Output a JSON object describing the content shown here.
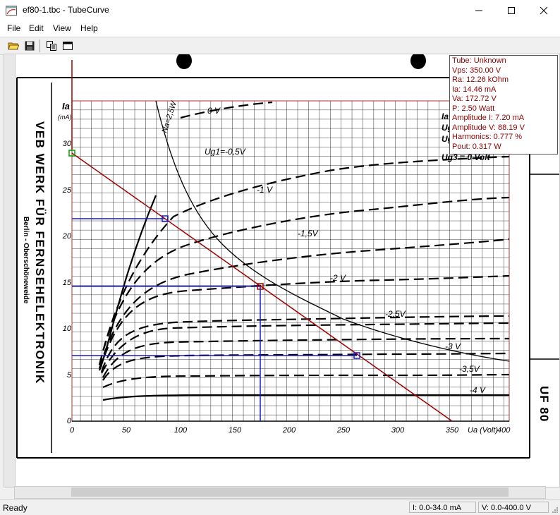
{
  "window": {
    "title": "ef80-1.tbc - TubeCurve",
    "minimize_glyph": "—",
    "close_glyph": "✕"
  },
  "menu": {
    "items": [
      "File",
      "Edit",
      "View",
      "Help"
    ]
  },
  "toolbar": {
    "icons": [
      "open-folder-icon",
      "save-icon",
      "copy-icon",
      "window-icon"
    ]
  },
  "info": {
    "tube": "Tube: Unknown",
    "vps": "Vps: 350.00 V",
    "ra": "Ra: 12.26 kOhm",
    "ia": "Ia: 14.46 mA",
    "va": "Va: 172.72 V",
    "p": "P: 2.50 Watt",
    "amplitude_i": "Amplitude I: 7.20 mA",
    "amplitude_v": "Amplitude V: 88.19 V",
    "harmonics": "Harmonics: 0.777 %",
    "pout": "Pout: 0.317 W"
  },
  "datasheet": {
    "maker": "VEB WERK FÜR FERNSEHELEKTRONIK",
    "location": "Berlin - Oberschöneweide",
    "tube_type": "UF 80",
    "y_axis_label": "Ia",
    "y_axis_unit": "(mA)",
    "x_axis_label": "Ua (Volt)",
    "x_max_label": "400",
    "y_ticks": [
      "0",
      "5",
      "10",
      "15",
      "20",
      "25",
      "30"
    ],
    "x_ticks": [
      "0",
      "50",
      "100",
      "150",
      "200",
      "250",
      "300",
      "350"
    ],
    "curve_labels": [
      "0 V",
      "Ug1=-0,5V",
      "-1 V",
      "-1,5V",
      "-2 V",
      "-2,5V",
      "-3 V",
      "-3,5V",
      "-4 V"
    ],
    "power_label": "Na=2,5W",
    "right_label_partial": [
      "Ia",
      "Ug",
      "Ug",
      "Ug3 = 0 Volt"
    ]
  },
  "status": {
    "text": "Ready",
    "i_range": "I: 0.0-34.0 mA",
    "v_range": "V: 0.0-400.0 V"
  },
  "colors": {
    "loadline": "#a00000",
    "operating_lines": "#1a1acc",
    "marker_green": "#00a000",
    "marker_blue": "#1a1acc",
    "grid_frame": "#b03030"
  }
}
